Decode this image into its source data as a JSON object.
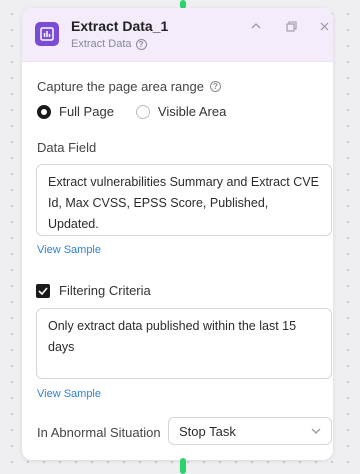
{
  "node": {
    "title": "Extract Data_1",
    "subtitle": "Extract Data",
    "icon": "table-chart-icon",
    "accent_color": "#7b4bd6"
  },
  "capture_range": {
    "label": "Capture the page area range",
    "options": [
      {
        "label": "Full Page",
        "selected": true
      },
      {
        "label": "Visible Area",
        "selected": false
      }
    ]
  },
  "data_field": {
    "label": "Data Field",
    "value": "Extract vulnerabilities Summary and Extract CVE Id, Max CVSS, EPSS Score, Published, Updated.",
    "view_sample": "View Sample"
  },
  "filtering": {
    "label": "Filtering Criteria",
    "checked": true,
    "value": "Only extract data published within the last 15 days",
    "view_sample": "View Sample"
  },
  "abnormal": {
    "label": "In Abnormal Situation",
    "selected": "Stop Task"
  }
}
